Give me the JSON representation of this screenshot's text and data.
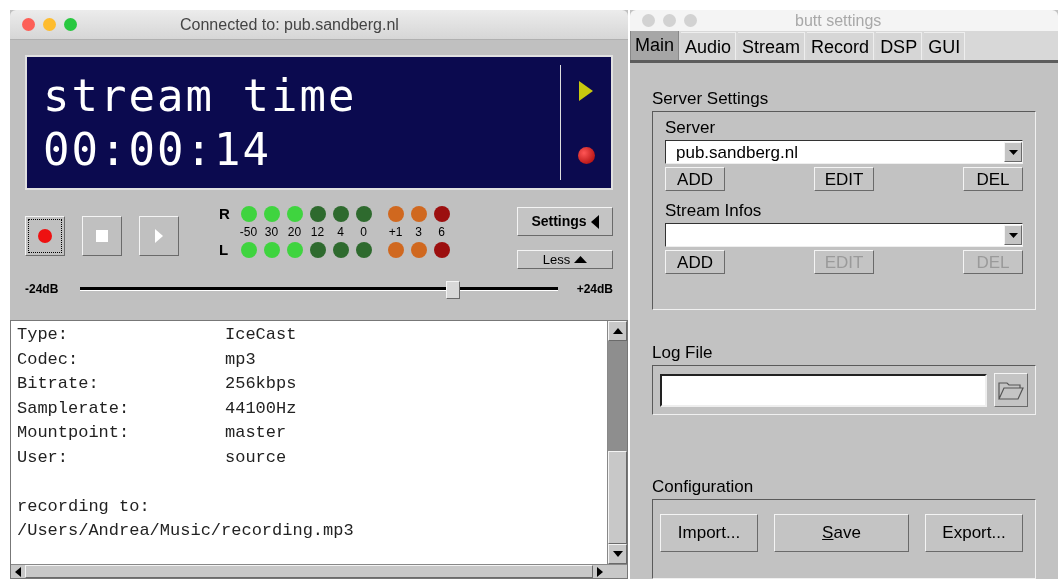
{
  "main_window": {
    "title": "Connected to:  pub.sandberg.nl",
    "display": {
      "line_1": "stream time",
      "line_2": "00:00:14"
    },
    "transport": [
      {
        "kind": "record",
        "focused": true
      },
      {
        "kind": "stop",
        "focused": false
      },
      {
        "kind": "play",
        "focused": false
      }
    ],
    "meter": {
      "scale": [
        "-50",
        "30",
        "20",
        "12",
        "4",
        "0",
        "+1",
        "3",
        "6"
      ],
      "channels": [
        {
          "label": "R",
          "leds": [
            {
              "color": "#3fd43f"
            },
            {
              "color": "#3fd43f"
            },
            {
              "color": "#3fd43f"
            },
            {
              "color": "#2e6a2e"
            },
            {
              "color": "#2e6a2e"
            },
            {
              "color": "#2e6a2e"
            },
            {
              "color": "#d0681f"
            },
            {
              "color": "#d0681f"
            },
            {
              "color": "#9c0f0f"
            }
          ]
        },
        {
          "label": "L",
          "leds": [
            {
              "color": "#3fd43f"
            },
            {
              "color": "#3fd43f"
            },
            {
              "color": "#3fd43f"
            },
            {
              "color": "#2e6a2e"
            },
            {
              "color": "#2e6a2e"
            },
            {
              "color": "#2e6a2e"
            },
            {
              "color": "#d0681f"
            },
            {
              "color": "#d0681f"
            },
            {
              "color": "#9c0f0f"
            }
          ]
        }
      ]
    },
    "settings_button": "Settings",
    "less_button": "Less",
    "gain": {
      "min_label": "-24dB",
      "max_label": "+24dB",
      "level": 0.78
    },
    "info": [
      {
        "label": "Type:",
        "value": "IceCast"
      },
      {
        "label": "Codec:",
        "value": "mp3"
      },
      {
        "label": "Bitrate:",
        "value": "256kbps"
      },
      {
        "label": "Samplerate:",
        "value": "44100Hz"
      },
      {
        "label": "Mountpoint:",
        "value": "master"
      },
      {
        "label": "User:",
        "value": "source"
      }
    ],
    "recording_label": "recording to:",
    "recording_path": "/Users/Andrea/Music/recording.mp3"
  },
  "settings_window": {
    "title": "butt settings",
    "tabs": [
      {
        "label": "Main",
        "selected": true
      },
      {
        "label": "Audio",
        "selected": false
      },
      {
        "label": "Stream",
        "selected": false
      },
      {
        "label": "Record",
        "selected": false
      },
      {
        "label": "DSP",
        "selected": false
      },
      {
        "label": "GUI",
        "selected": false
      }
    ],
    "server_settings": {
      "title": "Server Settings",
      "server": {
        "label": "Server",
        "value": "pub.sandberg.nl",
        "buttons": [
          {
            "label": "ADD",
            "disabled": false
          },
          {
            "label": "EDIT",
            "disabled": false
          },
          {
            "label": "DEL",
            "disabled": false
          }
        ]
      },
      "stream_infos": {
        "label": "Stream Infos",
        "buttons": [
          {
            "label": "ADD",
            "disabled": false
          },
          {
            "label": "EDIT",
            "disabled": true
          },
          {
            "label": "DEL",
            "disabled": true
          }
        ]
      }
    },
    "log_file": {
      "title": "Log File"
    },
    "configuration": {
      "title": "Configuration",
      "buttons": [
        {
          "label": "Import...",
          "mnemonic": false
        },
        {
          "label": "Save",
          "mnemonic": true
        },
        {
          "label": "Export...",
          "mnemonic": false
        }
      ]
    }
  }
}
